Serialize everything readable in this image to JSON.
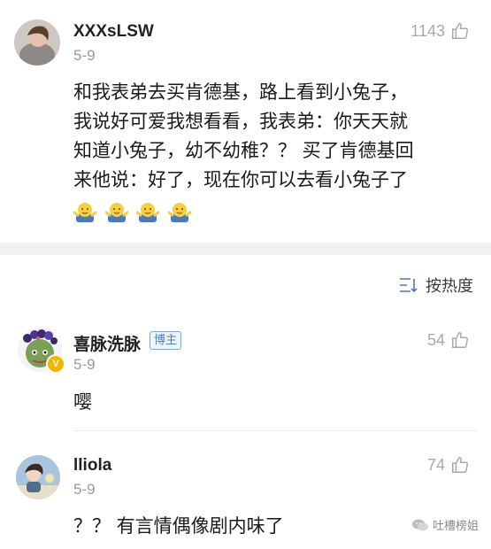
{
  "comments": [
    {
      "username": "XXXsLSW",
      "date": "5-9",
      "likes": "1143",
      "text_lines": [
        "和我表弟去买肯德基，路上看到小兔子，",
        "我说好可爱我想看看，我表弟：你天天就",
        "知道小兔子，幼不幼稚？？  买了肯德基回",
        "来他说：好了，现在你可以去看小兔子了"
      ],
      "emoji_icons": [
        "shrug-emoji-icon",
        "shrug-emoji-icon",
        "shrug-emoji-icon",
        "shrug-emoji-icon"
      ]
    }
  ],
  "sort": {
    "label": "按热度"
  },
  "replies": [
    {
      "username": "喜脉洗脉",
      "badge": "博主",
      "date": "5-9",
      "likes": "54",
      "text": "嘤"
    },
    {
      "username": "lliola",
      "date": "5-9",
      "likes": "74",
      "text": "？？ 有言情偶像剧内味了"
    }
  ],
  "watermark": {
    "text": "吐槽榜姐"
  },
  "colors": {
    "accent_blue": "#4a7cc0",
    "muted_gray": "#9a9a9a"
  }
}
